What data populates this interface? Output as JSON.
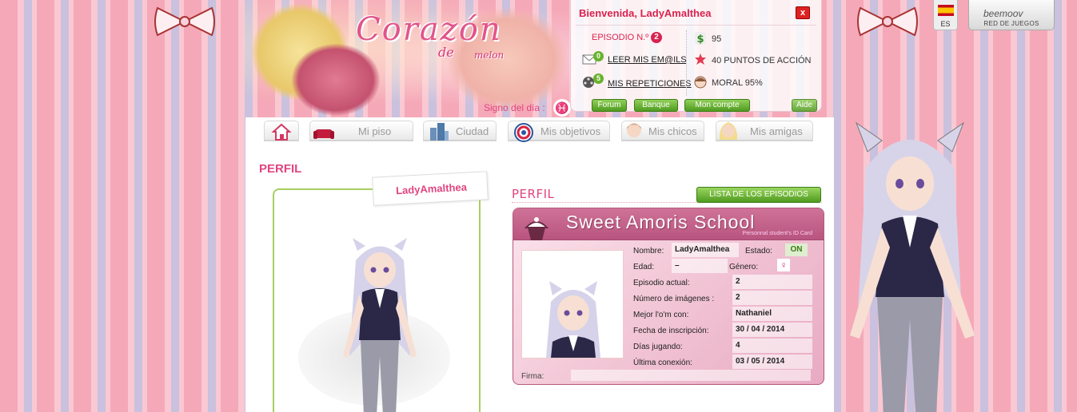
{
  "header": {
    "logo_main": "Corazón",
    "logo_de": "de",
    "logo_melon": "melon",
    "signo_label": "Signo del día :",
    "signo_symbol": "♓"
  },
  "welcome": {
    "title": "Bienvenida, LadyAmalthea",
    "close": "x",
    "episode_label": "EPISODIO N.º",
    "episode_number": "2",
    "emails_count": "0",
    "emails_label": "LEER MIS EM@ILS",
    "replays_count": "5",
    "replays_label": "MIS REPETICIONES",
    "money": "95",
    "action_points": "40 PUNTOS DE ACCIÓN",
    "moral": "MORAL 95%",
    "buttons": {
      "forum": "Forum",
      "shop": "Banque",
      "account": "Mon compte",
      "help": "Aide"
    }
  },
  "lang": {
    "code": "ES"
  },
  "network": {
    "logo": "beemoov",
    "subtitle": "RED DE JUEGOS"
  },
  "tabs": [
    {
      "label": ""
    },
    {
      "label": "Mi piso"
    },
    {
      "label": "Ciudad"
    },
    {
      "label": "Mis objetivos"
    },
    {
      "label": "Mis chicos"
    },
    {
      "label": "Mis amigas"
    }
  ],
  "page": {
    "title": "PERFIL",
    "username": "LadyAmalthea",
    "subtitle": "PERFIL",
    "episodes_button": "LISTA DE LOS EPISODIOS"
  },
  "idcard": {
    "school": "Sweet Amoris School",
    "card_sub": "Personnal student's ID Card",
    "name_label": "Nombre:",
    "name_value": "LadyAmalthea",
    "status_label": "Estado:",
    "status_value": "ON",
    "age_label": "Edad:",
    "age_value": "–",
    "gender_label": "Género:",
    "gender_symbol": "♀",
    "episode_label": "Episodio actual:",
    "episode_value": "2",
    "images_label": "Número de imágenes :",
    "images_value": "2",
    "best_label": "Mejor l'o'm con:",
    "best_value": "Nathaniel",
    "signup_label": "Fecha de inscripción:",
    "signup_value": "30 / 04 / 2014",
    "days_label": "Días jugando:",
    "days_value": "4",
    "last_label": "Última conexión:",
    "last_value": "03 / 05 / 2014",
    "firma_label": "Firma:"
  }
}
